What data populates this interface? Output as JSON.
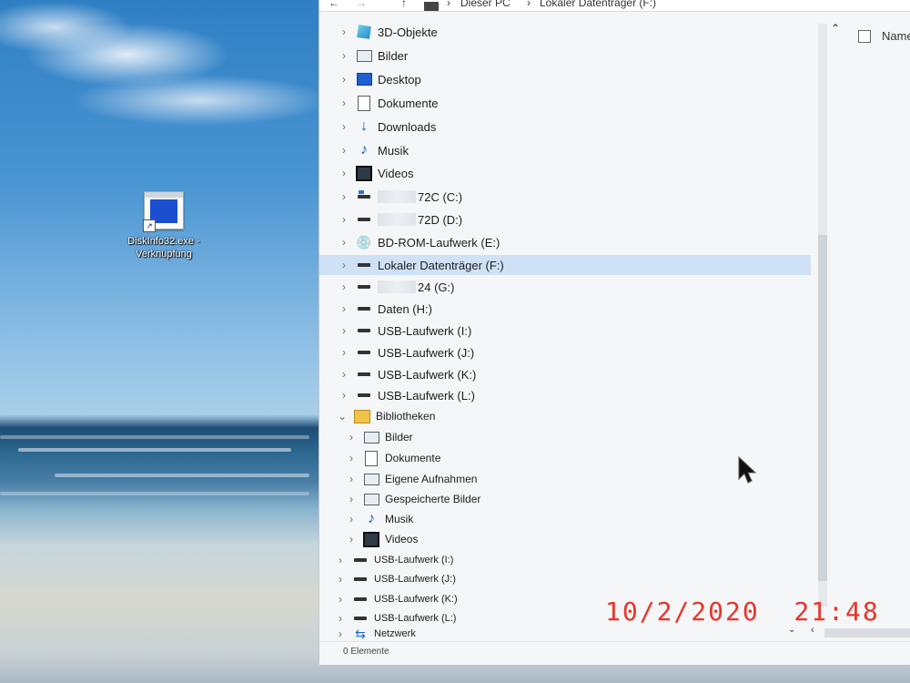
{
  "window": {
    "breadcrumb": [
      "Dieser PC",
      "Lokaler Datenträger (F:)"
    ],
    "column_header": "Name",
    "status": "0 Elemente"
  },
  "nav": {
    "this_pc_items": [
      {
        "label": "3D-Objekte",
        "icon": "3d-objects-icon"
      },
      {
        "label": "Bilder",
        "icon": "pictures-icon"
      },
      {
        "label": "Desktop",
        "icon": "desktop-icon"
      },
      {
        "label": "Dokumente",
        "icon": "documents-icon"
      },
      {
        "label": "Downloads",
        "icon": "downloads-icon"
      },
      {
        "label": "Musik",
        "icon": "music-icon"
      },
      {
        "label": "Videos",
        "icon": "videos-icon"
      }
    ],
    "drives": [
      {
        "label": "72C (C:)",
        "icon": "system-drive-icon",
        "redacted": true
      },
      {
        "label": "72D (D:)",
        "icon": "drive-icon",
        "redacted": true
      },
      {
        "label": "BD-ROM-Laufwerk (E:)",
        "icon": "bd-rom-icon"
      },
      {
        "label": "Lokaler Datenträger (F:)",
        "icon": "drive-icon",
        "selected": true
      },
      {
        "label": "24 (G:)",
        "icon": "drive-icon",
        "redacted": true
      },
      {
        "label": "Daten (H:)",
        "icon": "drive-icon"
      },
      {
        "label": "USB-Laufwerk (I:)",
        "icon": "usb-drive-icon"
      },
      {
        "label": "USB-Laufwerk (J:)",
        "icon": "usb-drive-icon"
      },
      {
        "label": "USB-Laufwerk (K:)",
        "icon": "usb-drive-icon"
      },
      {
        "label": "USB-Laufwerk (L:)",
        "icon": "usb-drive-icon"
      }
    ],
    "libraries_label": "Bibliotheken",
    "libraries": [
      {
        "label": "Bilder",
        "icon": "pictures-icon"
      },
      {
        "label": "Dokumente",
        "icon": "documents-icon"
      },
      {
        "label": "Eigene Aufnahmen",
        "icon": "pictures-icon"
      },
      {
        "label": "Gespeicherte Bilder",
        "icon": "pictures-icon"
      },
      {
        "label": "Musik",
        "icon": "music-icon"
      },
      {
        "label": "Videos",
        "icon": "videos-icon"
      }
    ],
    "usb_root": [
      {
        "label": "USB-Laufwerk (I:)"
      },
      {
        "label": "USB-Laufwerk (J:)"
      },
      {
        "label": "USB-Laufwerk (K:)"
      },
      {
        "label": "USB-Laufwerk (L:)"
      }
    ],
    "network_label": "Netzwerk"
  },
  "desktop_icon": {
    "label": "DiskInfo32.exe - Verknüpfung",
    "icon": "diskinfo-shortcut-icon"
  },
  "photo_timestamp": "10/2/2020  21:48"
}
